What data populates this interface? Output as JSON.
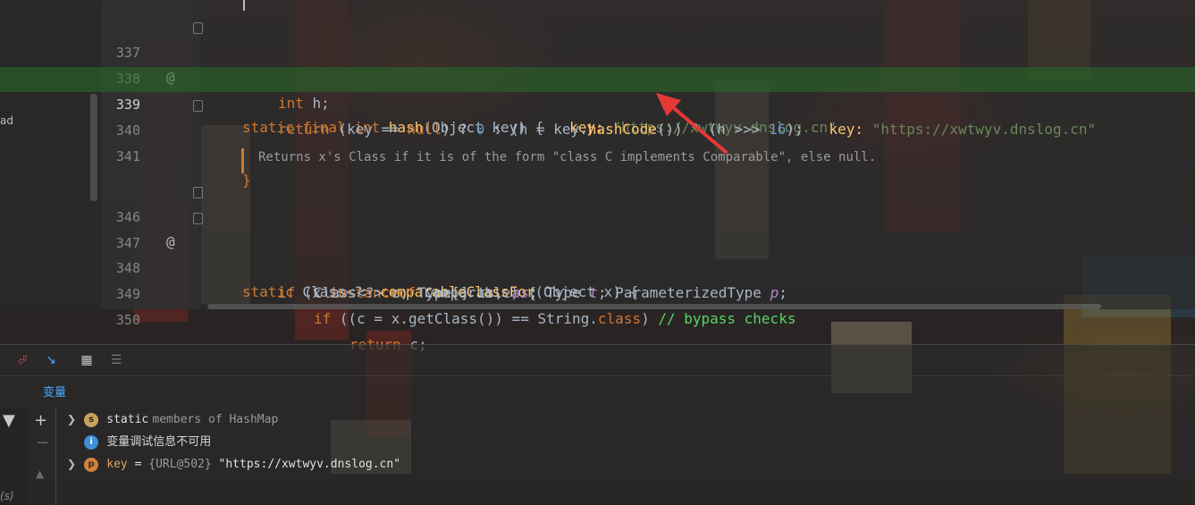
{
  "editor": {
    "left_fragment": "ad",
    "lines": [
      {
        "num": "337"
      },
      {
        "num": "338"
      },
      {
        "num": "339"
      },
      {
        "num": "340"
      },
      {
        "num": "341"
      },
      {
        "num": "346"
      },
      {
        "num": "347"
      },
      {
        "num": "348"
      },
      {
        "num": "349"
      },
      {
        "num": "350"
      }
    ],
    "code": {
      "l337_static": "static",
      "l337_final": "final",
      "l337_int": "int",
      "l337_fn": "hash",
      "l337_params": "(Object key) {",
      "l337_hint_name": "key:",
      "l337_hint_val": "\"https://xwtwyv.dnslog.cn\"",
      "l338_int": "int",
      "l338_rest": " h;",
      "l339_return": "return",
      "l339_a": " (key == ",
      "l339_null": "null",
      "l339_b": ") ? ",
      "l339_zero": "0",
      "l339_c": " : (h = key.",
      "l339_fn": "hashCode",
      "l339_d": "()) ^ (h >>> ",
      "l339_sixteen": "16",
      "l339_e": ");",
      "l339_hint_name": "key:",
      "l339_hint_val": "\"https://xwtwyv.dnslog.cn\"",
      "l340": "}",
      "doc": "Returns x's Class if it is of the form \"class C implements Comparable\", else null.",
      "l346_static": "static",
      "l346_type": " Class<?> ",
      "l346_fn": "comparableClassFor",
      "l346_rest": "(Object x) {",
      "l347_if": "if",
      "l347_a": " (x ",
      "l347_instanceof": "instanceof",
      "l347_b": " Comparable) {",
      "l348_a": "Class<?> c; Type[] ts, ",
      "l348_as": "as",
      "l348_b": "; Type ",
      "l348_t": "t",
      "l348_c": "; ParameterizedType ",
      "l348_p": "p",
      "l348_d": ";",
      "l349_if": "if",
      "l349_a": " ((c = x.getClass()) == String.",
      "l349_class": "class",
      "l349_b": ") ",
      "l349_comment": "// bypass checks",
      "l350_return": "return",
      "l350_rest": " c;"
    },
    "marks": {
      "at": "@"
    }
  },
  "panel": {
    "title": "变量",
    "vars": [
      {
        "badge": "s",
        "keyword": "static",
        "label": "members of HashMap"
      },
      {
        "badge": "i",
        "label": "变量调试信息不可用"
      },
      {
        "badge": "p",
        "name": "key",
        "eq": " = ",
        "type": "{URL@502}",
        "value": " \"https://xwtwyv.dnslog.cn\""
      }
    ],
    "bottom_fragment": "(s)"
  },
  "colors": {
    "keyword": "#cc7832",
    "function": "#ffc66d",
    "string": "#6a8759",
    "number": "#6897bb",
    "current_line": "#2a6e2a",
    "arrow": "#e53935",
    "link": "#4aa8ff"
  }
}
